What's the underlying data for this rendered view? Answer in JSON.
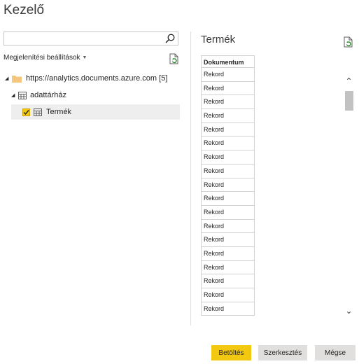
{
  "dialog": {
    "title": "Kezelő"
  },
  "search": {
    "value": "",
    "placeholder": ""
  },
  "display_settings": {
    "label": "Megjelenítési beállítások"
  },
  "tree": {
    "source": {
      "label": "https://analytics.documents.azure.com [5]",
      "icon": "folder-icon"
    },
    "database": {
      "label": "adattárház",
      "icon": "table-icon"
    },
    "table": {
      "label": "Termék",
      "checked": true,
      "icon": "table-icon"
    }
  },
  "preview": {
    "title": "Termék",
    "columns": [
      "Dokumentum"
    ],
    "rows": [
      "Rekord",
      "Rekord",
      "Rekord",
      "Rekord",
      "Rekord",
      "Rekord",
      "Rekord",
      "Rekord",
      "Rekord",
      "Rekord",
      "Rekord",
      "Rekord",
      "Rekord",
      "Rekord",
      "Rekord",
      "Rekord",
      "Rekord",
      "Rekord"
    ]
  },
  "buttons": {
    "load": "Betöltés",
    "edit": "Szerkesztés",
    "cancel": "Mégse"
  },
  "colors": {
    "accent": "#f2c811",
    "folder": "#f5c77e",
    "selection": "#eeeeee"
  }
}
